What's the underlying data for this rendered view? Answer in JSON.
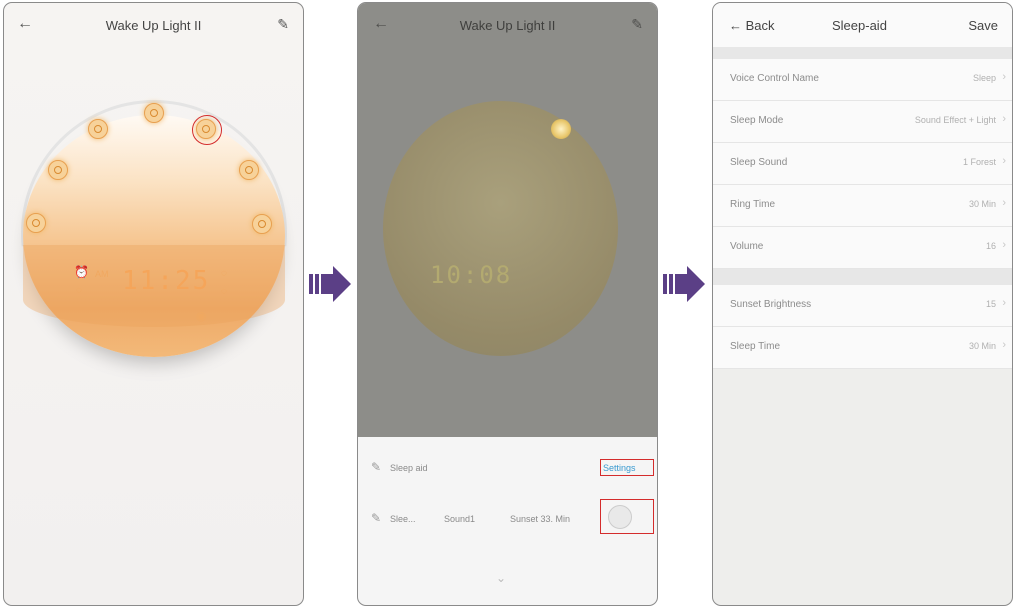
{
  "screen1": {
    "title": "Wake Up Light II",
    "back_icon": "back-arrow-icon",
    "edit_icon": "pencil-icon",
    "clock_time": "11:25",
    "am_label": "AM"
  },
  "screen2": {
    "title": "Wake Up Light II",
    "lcd_time": "10:08",
    "row1": {
      "label": "Sleep aid",
      "action": "Settings"
    },
    "row2": {
      "label": "Slee...",
      "c1": "Sound1",
      "c2": "Sunset 33. Min"
    }
  },
  "screen3": {
    "back_label": "← Back",
    "title": "Sleep-aid",
    "save_label": "Save",
    "items": [
      {
        "label": "Voice Control Name",
        "value": "Sleep"
      },
      {
        "label": "Sleep Mode",
        "value": "Sound Effect + Light"
      },
      {
        "label": "Sleep Sound",
        "value": "1 Forest"
      },
      {
        "label": "Ring Time",
        "value": "30 Min"
      },
      {
        "label": "Volume",
        "value": "16"
      }
    ],
    "items2": [
      {
        "label": "Sunset Brightness",
        "value": "15"
      },
      {
        "label": "Sleep Time",
        "value": "30 Min"
      }
    ]
  },
  "colors": {
    "arrow": "#5b3f86",
    "highlight": "#d42c2c",
    "dome": "#f5c38c"
  }
}
